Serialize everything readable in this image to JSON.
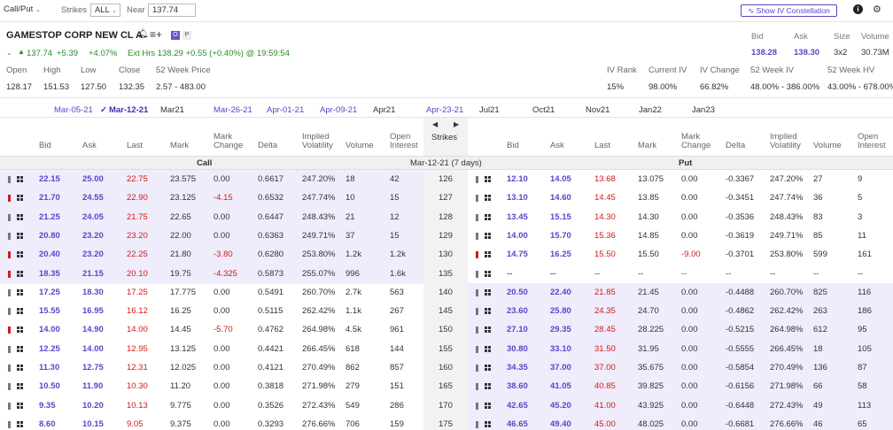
{
  "toolbar": {
    "call_put": "Call/Put",
    "strikes_label": "Strikes",
    "strikes_value": "ALL",
    "near_label": "Near",
    "near_value": "137.74",
    "iv_button": "Show IV Constellation"
  },
  "quote": {
    "name": "GAMESTOP CORP NEW CL A",
    "badge_o": "O",
    "badge_p": "P",
    "last": "137.74",
    "change": "+5.39",
    "change_pct": "+4.07%",
    "ext_hrs": "Ext Hrs 138.29 +0.55 (+0.40%) @ 19:59:54",
    "bid_label": "Bid",
    "ask_label": "Ask",
    "size_label": "Size",
    "volume_label": "Volume",
    "bid": "138.28",
    "ask": "138.30",
    "size": "3x2",
    "volume": "30.73M"
  },
  "stats": {
    "labels": [
      "Open",
      "High",
      "Low",
      "Close",
      "52 Week Price"
    ],
    "values": [
      "128.17",
      "151.53",
      "127.50",
      "132.35",
      "2.57 - 483.00"
    ],
    "iv_labels": [
      "IV Rank",
      "Current IV",
      "IV Change",
      "52 Week IV",
      "52 Week HV"
    ],
    "iv_values": [
      "15%",
      "98.00%",
      "66.82%",
      "48.00% - 386.00%",
      "43.00% - 678.00%"
    ]
  },
  "expirations": [
    "Mar-05-21",
    "Mar-12-21",
    "Mar21",
    "Mar-26-21",
    "Apr-01-21",
    "Apr-09-21",
    "Apr21",
    "Apr-23-21",
    "Jul21",
    "Oct21",
    "Nov21",
    "Jan22",
    "Jan23"
  ],
  "columns": {
    "bid": "Bid",
    "ask": "Ask",
    "last": "Last",
    "mark": "Mark",
    "mark_change_1": "Mark",
    "mark_change_2": "Change",
    "delta": "Delta",
    "iv_1": "Implied",
    "iv_2": "Volatility",
    "volume": "Volume",
    "oi_1": "Open",
    "oi_2": "Interest",
    "strikes": "Strikes"
  },
  "section": {
    "call": "Call",
    "put": "Put",
    "expiry": "Mar-12-21 (7 days)"
  },
  "rows": [
    {
      "strike": "126",
      "itm_call": true,
      "itm_put": false,
      "call": {
        "bid": "22.15",
        "ask": "25.00",
        "last": "22.75",
        "mark": "23.575",
        "chg": "0.00",
        "delta": "0.6617",
        "iv": "247.20%",
        "vol": "18",
        "oi": "42",
        "flag": "grey"
      },
      "put": {
        "bid": "12.10",
        "ask": "14.05",
        "last": "13.68",
        "mark": "13.075",
        "chg": "0.00",
        "delta": "-0.3367",
        "iv": "247.20%",
        "vol": "27",
        "oi": "9",
        "flag": "grey"
      }
    },
    {
      "strike": "127",
      "itm_call": true,
      "itm_put": false,
      "call": {
        "bid": "21.70",
        "ask": "24.55",
        "last": "22.90",
        "mark": "23.125",
        "chg": "-4.15",
        "delta": "0.6532",
        "iv": "247.74%",
        "vol": "10",
        "oi": "15",
        "flag": "red"
      },
      "put": {
        "bid": "13.10",
        "ask": "14.60",
        "last": "14.45",
        "mark": "13.85",
        "chg": "0.00",
        "delta": "-0.3451",
        "iv": "247.74%",
        "vol": "36",
        "oi": "5",
        "flag": "grey"
      }
    },
    {
      "strike": "128",
      "itm_call": true,
      "itm_put": false,
      "call": {
        "bid": "21.25",
        "ask": "24.05",
        "last": "21.75",
        "mark": "22.65",
        "chg": "0.00",
        "delta": "0.6447",
        "iv": "248.43%",
        "vol": "21",
        "oi": "12",
        "flag": "grey"
      },
      "put": {
        "bid": "13.45",
        "ask": "15.15",
        "last": "14.30",
        "mark": "14.30",
        "chg": "0.00",
        "delta": "-0.3536",
        "iv": "248.43%",
        "vol": "83",
        "oi": "3",
        "flag": "grey"
      }
    },
    {
      "strike": "129",
      "itm_call": true,
      "itm_put": false,
      "call": {
        "bid": "20.80",
        "ask": "23.20",
        "last": "23.20",
        "mark": "22.00",
        "chg": "0.00",
        "delta": "0.6363",
        "iv": "249.71%",
        "vol": "37",
        "oi": "15",
        "flag": "grey"
      },
      "put": {
        "bid": "14.00",
        "ask": "15.70",
        "last": "15.36",
        "mark": "14.85",
        "chg": "0.00",
        "delta": "-0.3619",
        "iv": "249.71%",
        "vol": "85",
        "oi": "11",
        "flag": "grey"
      }
    },
    {
      "strike": "130",
      "itm_call": true,
      "itm_put": false,
      "call": {
        "bid": "20.40",
        "ask": "23.20",
        "last": "22.25",
        "mark": "21.80",
        "chg": "-3.80",
        "delta": "0.6280",
        "iv": "253.80%",
        "vol": "1.2k",
        "oi": "1.2k",
        "flag": "red"
      },
      "put": {
        "bid": "14.75",
        "ask": "16.25",
        "last": "15.50",
        "mark": "15.50",
        "chg": "-9.00",
        "delta": "-0.3701",
        "iv": "253.80%",
        "vol": "599",
        "oi": "161",
        "flag": "red"
      }
    },
    {
      "strike": "135",
      "itm_call": true,
      "itm_put": false,
      "call": {
        "bid": "18.35",
        "ask": "21.15",
        "last": "20.10",
        "mark": "19.75",
        "chg": "-4.325",
        "delta": "0.5873",
        "iv": "255.07%",
        "vol": "996",
        "oi": "1.6k",
        "flag": "red"
      },
      "put": {
        "bid": "--",
        "ask": "--",
        "last": "--",
        "mark": "--",
        "chg": "--",
        "delta": "--",
        "iv": "--",
        "vol": "--",
        "oi": "--",
        "flag": "grey"
      }
    },
    {
      "strike": "140",
      "itm_call": false,
      "itm_put": true,
      "call": {
        "bid": "17.25",
        "ask": "18.30",
        "last": "17.25",
        "mark": "17.775",
        "chg": "0.00",
        "delta": "0.5491",
        "iv": "260.70%",
        "vol": "2.7k",
        "oi": "563",
        "flag": "grey"
      },
      "put": {
        "bid": "20.50",
        "ask": "22.40",
        "last": "21.85",
        "mark": "21.45",
        "chg": "0.00",
        "delta": "-0.4488",
        "iv": "260.70%",
        "vol": "825",
        "oi": "116",
        "flag": "grey"
      }
    },
    {
      "strike": "145",
      "itm_call": false,
      "itm_put": true,
      "call": {
        "bid": "15.55",
        "ask": "16.95",
        "last": "16.12",
        "mark": "16.25",
        "chg": "0.00",
        "delta": "0.5115",
        "iv": "262.42%",
        "vol": "1.1k",
        "oi": "267",
        "flag": "grey"
      },
      "put": {
        "bid": "23.60",
        "ask": "25.80",
        "last": "24.35",
        "mark": "24.70",
        "chg": "0.00",
        "delta": "-0.4862",
        "iv": "262.42%",
        "vol": "263",
        "oi": "186",
        "flag": "grey"
      }
    },
    {
      "strike": "150",
      "itm_call": false,
      "itm_put": true,
      "call": {
        "bid": "14.00",
        "ask": "14.90",
        "last": "14.00",
        "mark": "14.45",
        "chg": "-5.70",
        "delta": "0.4762",
        "iv": "264.98%",
        "vol": "4.5k",
        "oi": "961",
        "flag": "red"
      },
      "put": {
        "bid": "27.10",
        "ask": "29.35",
        "last": "28.45",
        "mark": "28.225",
        "chg": "0.00",
        "delta": "-0.5215",
        "iv": "264.98%",
        "vol": "612",
        "oi": "95",
        "flag": "grey"
      }
    },
    {
      "strike": "155",
      "itm_call": false,
      "itm_put": true,
      "call": {
        "bid": "12.25",
        "ask": "14.00",
        "last": "12.95",
        "mark": "13.125",
        "chg": "0.00",
        "delta": "0.4421",
        "iv": "266.45%",
        "vol": "618",
        "oi": "144",
        "flag": "grey"
      },
      "put": {
        "bid": "30.80",
        "ask": "33.10",
        "last": "31.50",
        "mark": "31.95",
        "chg": "0.00",
        "delta": "-0.5555",
        "iv": "266.45%",
        "vol": "18",
        "oi": "105",
        "flag": "grey"
      }
    },
    {
      "strike": "160",
      "itm_call": false,
      "itm_put": true,
      "call": {
        "bid": "11.30",
        "ask": "12.75",
        "last": "12.31",
        "mark": "12.025",
        "chg": "0.00",
        "delta": "0.4121",
        "iv": "270.49%",
        "vol": "862",
        "oi": "857",
        "flag": "grey"
      },
      "put": {
        "bid": "34.35",
        "ask": "37.00",
        "last": "37.00",
        "mark": "35.675",
        "chg": "0.00",
        "delta": "-0.5854",
        "iv": "270.49%",
        "vol": "136",
        "oi": "87",
        "flag": "grey"
      }
    },
    {
      "strike": "165",
      "itm_call": false,
      "itm_put": true,
      "call": {
        "bid": "10.50",
        "ask": "11.90",
        "last": "10.30",
        "mark": "11.20",
        "chg": "0.00",
        "delta": "0.3818",
        "iv": "271.98%",
        "vol": "279",
        "oi": "151",
        "flag": "grey"
      },
      "put": {
        "bid": "38.60",
        "ask": "41.05",
        "last": "40.85",
        "mark": "39.825",
        "chg": "0.00",
        "delta": "-0.6156",
        "iv": "271.98%",
        "vol": "66",
        "oi": "58",
        "flag": "grey"
      }
    },
    {
      "strike": "170",
      "itm_call": false,
      "itm_put": true,
      "call": {
        "bid": "9.35",
        "ask": "10.20",
        "last": "10.13",
        "mark": "9.775",
        "chg": "0.00",
        "delta": "0.3526",
        "iv": "272.43%",
        "vol": "549",
        "oi": "286",
        "flag": "grey"
      },
      "put": {
        "bid": "42.65",
        "ask": "45.20",
        "last": "41.00",
        "mark": "43.925",
        "chg": "0.00",
        "delta": "-0.6448",
        "iv": "272.43%",
        "vol": "49",
        "oi": "113",
        "flag": "grey"
      }
    },
    {
      "strike": "175",
      "itm_call": false,
      "itm_put": true,
      "call": {
        "bid": "8.60",
        "ask": "10.15",
        "last": "9.05",
        "mark": "9.375",
        "chg": "0.00",
        "delta": "0.3293",
        "iv": "276.66%",
        "vol": "706",
        "oi": "159",
        "flag": "grey"
      },
      "put": {
        "bid": "46.65",
        "ask": "49.40",
        "last": "45.00",
        "mark": "48.025",
        "chg": "0.00",
        "delta": "-0.6681",
        "iv": "276.66%",
        "vol": "46",
        "oi": "65",
        "flag": "grey"
      }
    }
  ]
}
